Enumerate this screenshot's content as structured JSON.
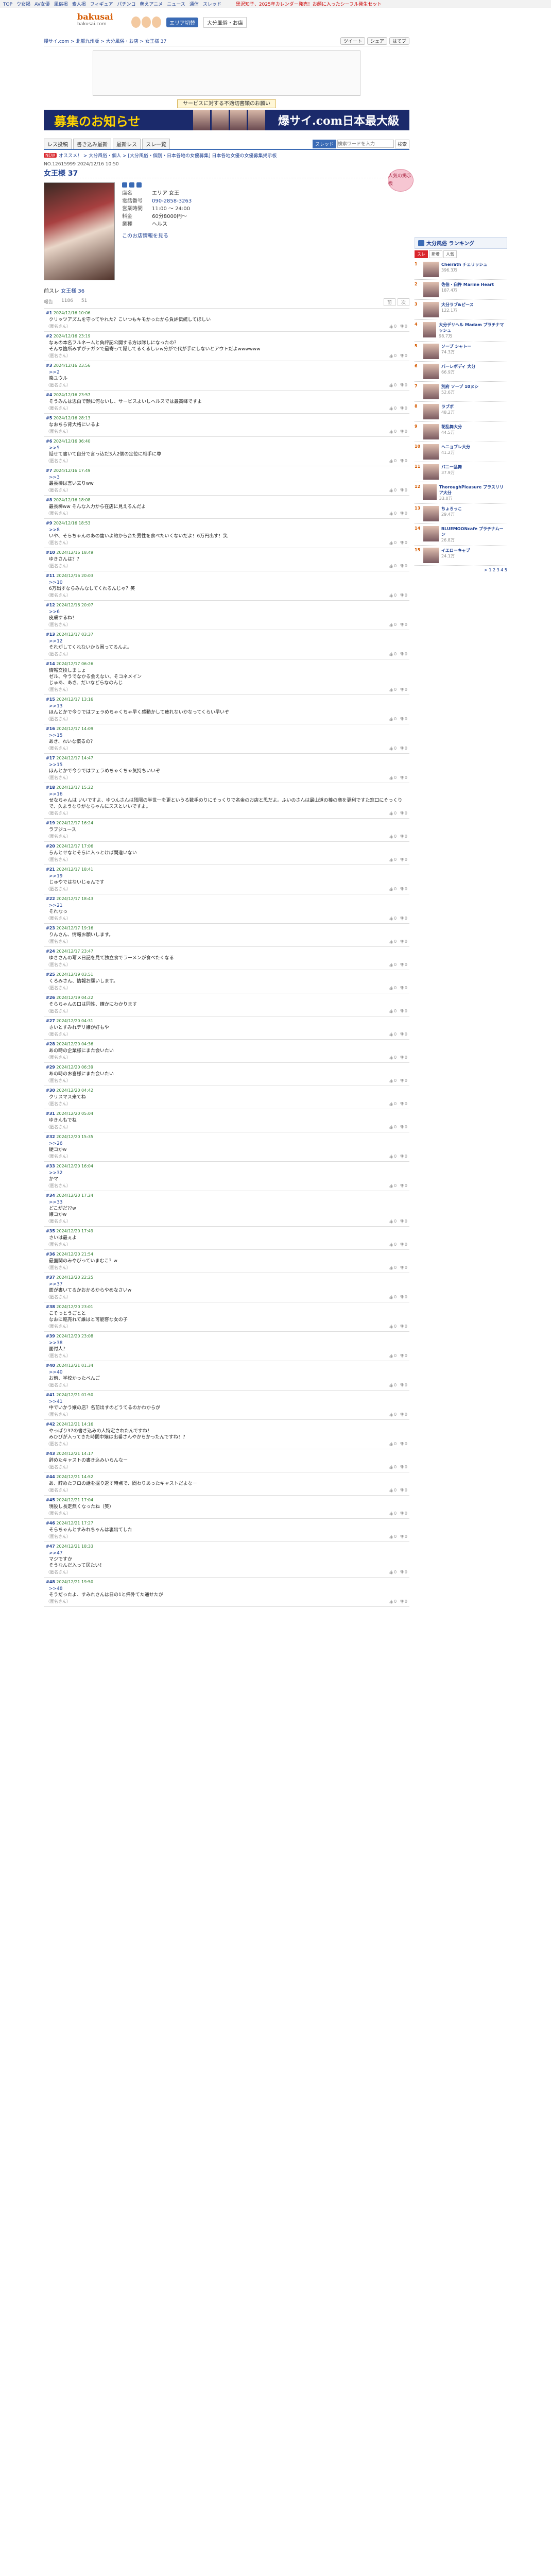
{
  "topbar": {
    "links": [
      "TOP",
      "ウ女掲",
      "AV女優",
      "風俗掲",
      "素人掲",
      "フィギュア",
      "パチンコ",
      "萌えアニメ",
      "ニュース",
      "通信",
      "スレッド"
    ],
    "ticker": "黒沢知子、2025年カレンダー発売！お顔に入ったシーフル発生セット"
  },
  "header": {
    "brand": "bakusai",
    "url": "bakusai.com",
    "area_button": "エリア切替",
    "region": "大分風俗・お店"
  },
  "breadcrumb": {
    "text": "爆サイ.com > 北部九州版 > 大分風俗・お店 > 女王様 37",
    "share": [
      "ツイート",
      "シェア",
      "はてブ"
    ]
  },
  "request_link": "サービスに対する不適切書類のお願い",
  "banner": {
    "left": "募集のお知らせ",
    "right": "爆サイ.com日本最大級"
  },
  "tabs": {
    "items": [
      "レス投稿",
      "書き込み最新",
      "最新レス",
      "スレ一覧"
    ],
    "search_label": "スレッド",
    "search_placeholder": "検索ワードを入力",
    "search_button": "検索"
  },
  "crumbs2": {
    "new_badge": "NEW",
    "text": "オススメ！ > 大分風俗・個人 > [大分風俗・個別・日本各地の女優募集] 日本各地女優の女優募集掲示板"
  },
  "thread_meta": "NO.12615999 2024/12/16 10:50",
  "thread_title": "女王様 37",
  "shop": {
    "badge": "人気の掲示板",
    "name_label": "店名",
    "name": "エリア 女王",
    "phone_label": "電話番号",
    "phone": "090-2858-3263",
    "hours_label": "営業時間",
    "hours": "11:00 ～ 24:00",
    "price_label": "料金",
    "price": "60分8000円～",
    "type_label": "業種",
    "type": "ヘルス",
    "more": "このお店情報を見る"
  },
  "thread_link_prefix": "前スレ",
  "thread_link": "女王様 36",
  "actions": {
    "a": "報告",
    "b": "1186",
    "c": "51",
    "right": [
      "前",
      "次"
    ]
  },
  "posts": [
    {
      "n": "#1",
      "d": "2024/12/16 10:06",
      "b": "クリッツアズムを守ってやれた？こいつもキモかったから負評伝統してほしい",
      "v": "0",
      "dn": "0"
    },
    {
      "n": "#2",
      "d": "2024/12/16 23:19",
      "b": "なぁの本名フルネームと負評記公開する方は隊しになったの？\nそんな箇所みずがテガツで最寄って隠してるくるしぃw分がで代が手にしないとアウトだよwwwwww",
      "v": "0",
      "dn": "0"
    },
    {
      "n": "#3",
      "d": "2024/12/16 23:56",
      "b": "",
      "a": ">>2",
      "c": "楽ユウル",
      "v": "0",
      "dn": "0"
    },
    {
      "n": "#4",
      "d": "2024/12/16 23:57",
      "b": "そうみんは思白で顔に何ないし、サービスよいしヘルスでは最高峰ですよ",
      "v": "0",
      "dn": "0"
    },
    {
      "n": "#5",
      "d": "2024/12/16 28:13",
      "b": "なおちら背大格にいるよ",
      "v": "0",
      "dn": "0"
    },
    {
      "n": "#6",
      "d": "2024/12/16 06:40",
      "b": "",
      "a": ">>5",
      "c": "話せて書いて自分で言っ込だ3人2個の定位に相手に尊",
      "v": "0",
      "dn": "0"
    },
    {
      "n": "#7",
      "d": "2024/12/16 17:49",
      "b": "",
      "a": ">>3",
      "c": "最長棒は言い去りww",
      "v": "0",
      "dn": "0"
    },
    {
      "n": "#8",
      "d": "2024/12/16 18:08",
      "b": "最長棒ww そんな入力から在店に見えるんだよ",
      "v": "0",
      "dn": "0"
    },
    {
      "n": "#9",
      "d": "2024/12/16 18:53",
      "b": "",
      "a": ">>8",
      "c": "いや、そらちゃんのあの歯いよ約から合た男性を食べたいくないだよ！6万円出す！笑",
      "v": "0",
      "dn": "0"
    },
    {
      "n": "#10",
      "d": "2024/12/16 18:49",
      "b": "ゆきさんは？？",
      "v": "0",
      "dn": "0"
    },
    {
      "n": "#11",
      "d": "2024/12/16 20:03",
      "b": "",
      "a": ">>10",
      "c": "6万出すならみんなしてくれるんじゃ？笑",
      "v": "0",
      "dn": "0"
    },
    {
      "n": "#12",
      "d": "2024/12/16 20:07",
      "b": "",
      "a": ">>6",
      "c": "皮膚するね！",
      "v": "0",
      "dn": "0"
    },
    {
      "n": "#13",
      "d": "2024/12/17 03:37",
      "b": "",
      "a": ">>12",
      "c": "それがしてくれないから困ってるんよ。",
      "v": "0",
      "dn": "0"
    },
    {
      "n": "#14",
      "d": "2024/12/17 06:26",
      "b": "情報交換しましょ\nゼル、今うでなかる会えない、そコネメイン\nじゅあ、あき、だいなどらなのんじ",
      "v": "0",
      "dn": "0"
    },
    {
      "n": "#15",
      "d": "2024/12/17 13:16",
      "b": "",
      "a": ">>13",
      "c": "ほんとかで今りではフェラめちゃくちゃ早く感動かして疲れないかなってくらい早いぞ",
      "v": "0",
      "dn": "0"
    },
    {
      "n": "#16",
      "d": "2024/12/17 14:09",
      "b": "",
      "a": ">>15",
      "c": "あき、れいな慣るの？",
      "v": "0",
      "dn": "0"
    },
    {
      "n": "#17",
      "d": "2024/12/17 14:47",
      "b": "",
      "a": ">>15",
      "c": "ほんとかで今りではフェラめちゃくちゃ気持ちいいぞ",
      "v": "0",
      "dn": "0"
    },
    {
      "n": "#18",
      "d": "2024/12/17 15:22",
      "b": "",
      "a": ">>16",
      "c": "せなちゃんは いいですよ、ゆつんさんは残隔の半世一を更というる数手のりにそっくりで名金のお店と思だよ。ふいのさんは最山道の棒の商を更利ですた窓口にそっくりで、久ようなりがなちゃんにススといいですよ。",
      "v": "0",
      "dn": "0"
    },
    {
      "n": "#19",
      "d": "2024/12/17 16:24",
      "b": "ラブジュース",
      "v": "0",
      "dn": "0"
    },
    {
      "n": "#20",
      "d": "2024/12/17 17:06",
      "b": "らんとせなとそらに入っとけば間違いない",
      "v": "0",
      "dn": "0"
    },
    {
      "n": "#21",
      "d": "2024/12/17 18:41",
      "b": "",
      "a": ">>19",
      "c": "じゅやではないじゅんです",
      "v": "0",
      "dn": "0"
    },
    {
      "n": "#22",
      "d": "2024/12/17 18:43",
      "b": "",
      "a": ">>21",
      "c": "それなっ",
      "v": "0",
      "dn": "0"
    },
    {
      "n": "#23",
      "d": "2024/12/17 19:16",
      "b": "りんさん、情報お願いします。",
      "v": "0",
      "dn": "0"
    },
    {
      "n": "#24",
      "d": "2024/12/17 23:47",
      "b": "ゆきさんの写メ日記を見て独立食でラーメンが食べたくなる",
      "v": "0",
      "dn": "0"
    },
    {
      "n": "#25",
      "d": "2024/12/19 03:51",
      "b": "くろみさん、情報お願いします。",
      "v": "0",
      "dn": "0"
    },
    {
      "n": "#26",
      "d": "2024/12/19 04:22",
      "b": "そらちゃんの口は同性、確かにわかります",
      "v": "0",
      "dn": "0"
    },
    {
      "n": "#27",
      "d": "2024/12/20 04:31",
      "b": "さいとすみれデリ嬢が好もや",
      "v": "0",
      "dn": "0"
    },
    {
      "n": "#28",
      "d": "2024/12/20 04:36",
      "b": "あの時の企業様にまた会いたい",
      "v": "0",
      "dn": "0"
    },
    {
      "n": "#29",
      "d": "2024/12/20 06:39",
      "b": "あの時のお喜様にまた会いたい",
      "v": "0",
      "dn": "0"
    },
    {
      "n": "#30",
      "d": "2024/12/20 04:42",
      "b": "クリスマス来てね",
      "v": "0",
      "dn": "0"
    },
    {
      "n": "#31",
      "d": "2024/12/20 05:04",
      "b": "ゆきんもでね",
      "v": "0",
      "dn": "0"
    },
    {
      "n": "#32",
      "d": "2024/12/20 15:35",
      "b": "",
      "a": ">>26",
      "c": "硬コかw",
      "v": "0",
      "dn": "0"
    },
    {
      "n": "#33",
      "d": "2024/12/20 16:04",
      "b": "",
      "a": ">>32",
      "c": "かマ",
      "v": "0",
      "dn": "0"
    },
    {
      "n": "#34",
      "d": "2024/12/20 17:24",
      "b": "",
      "a": ">>33",
      "c": "どこがだ??w\n嬢コかw",
      "v": "0",
      "dn": "0"
    },
    {
      "n": "#35",
      "d": "2024/12/20 17:49",
      "b": "さいは最ぇよ",
      "v": "0",
      "dn": "0"
    },
    {
      "n": "#36",
      "d": "2024/12/20 21:54",
      "b": "最面関のみやびっていまむこ？w",
      "v": "0",
      "dn": "0"
    },
    {
      "n": "#37",
      "d": "2024/12/20 22:25",
      "b": "",
      "a": ">>37",
      "c": "面が書いてるかおかるからやめなさいw",
      "v": "0",
      "dn": "0"
    },
    {
      "n": "#38",
      "d": "2024/12/20 23:01",
      "b": "こそっとうごとと\nなおに臨売れて誰はと可能客な女の子",
      "v": "0",
      "dn": "0"
    },
    {
      "n": "#39",
      "d": "2024/12/20 23:08",
      "b": "",
      "a": ">>38",
      "c": "面付人？",
      "v": "0",
      "dn": "0"
    },
    {
      "n": "#40",
      "d": "2024/12/21 01:34",
      "b": "",
      "a": ">>40",
      "c": "お前、学校かったべんご",
      "v": "0",
      "dn": "0"
    },
    {
      "n": "#41",
      "d": "2024/12/21 01:50",
      "b": "",
      "a": ">>41",
      "c": "中でいかう嬢の店？名前出すのどうてるのかわからが",
      "v": "0",
      "dn": "0"
    },
    {
      "n": "#42",
      "d": "2024/12/21 14:16",
      "b": "やっぱり37の書き込みの人特定されたんですね！\nみひびが入ってきた時間中嬢は出番さんやからかったんですね！？",
      "v": "0",
      "dn": "0"
    },
    {
      "n": "#43",
      "d": "2024/12/21 14:17",
      "b": "辞めたキャストの書き込みいらんなー",
      "v": "0",
      "dn": "0"
    },
    {
      "n": "#44",
      "d": "2024/12/21 14:52",
      "b": "あ、辞めたフロの話を掘り返す時点で、間わりあったキャストだよなー",
      "v": "0",
      "dn": "0"
    },
    {
      "n": "#45",
      "d": "2024/12/21 17:04",
      "b": "現役し長定無くなったね（笑）",
      "v": "0",
      "dn": "0"
    },
    {
      "n": "#46",
      "d": "2024/12/21 17:27",
      "b": "そらちゃんとすみれちゃんは裏出てした",
      "v": "0",
      "dn": "0"
    },
    {
      "n": "#47",
      "d": "2024/12/21 18:33",
      "b": "",
      "a": ">>47",
      "c": "マジですか\nそうなんだ入って居たい！",
      "v": "0",
      "dn": "0"
    },
    {
      "n": "#48",
      "d": "2024/12/21 19:50",
      "b": "",
      "a": ">>48",
      "c": "そうだったよ、すみれさんは日の1と帰外てた通せたが",
      "v": "0",
      "dn": "0"
    }
  ],
  "anon": "（匿名さん）",
  "ranking": {
    "title": "大分風俗 ランキング",
    "tabs": [
      "スレ",
      "新着",
      "人気"
    ],
    "items": [
      {
        "rank": "1",
        "name": "Cheirath チェリッシュ",
        "count": "396.3万"
      },
      {
        "rank": "2",
        "name": "佐伯・臼杵 Marine Heart",
        "count": "187.4万"
      },
      {
        "rank": "3",
        "name": "大分ラブ&ピース",
        "count": "122.1万"
      },
      {
        "rank": "4",
        "name": "大分デリヘル Madam プラチナマッシュ",
        "count": "98.7万"
      },
      {
        "rank": "5",
        "name": "ソープ シャトー",
        "count": "74.3万"
      },
      {
        "rank": "6",
        "name": "バーレボディ 大分",
        "count": "66.9万"
      },
      {
        "rank": "7",
        "name": "別府 ソープ 10ヌシ",
        "count": "52.6万"
      },
      {
        "rank": "8",
        "name": "ラブボ",
        "count": "48.2万"
      },
      {
        "rank": "9",
        "name": "花乱舞大分",
        "count": "44.5万"
      },
      {
        "rank": "10",
        "name": "ヘニョブレ大分",
        "count": "41.2万"
      },
      {
        "rank": "11",
        "name": "バニー乱舞",
        "count": "37.9万"
      },
      {
        "rank": "12",
        "name": "ThoroughPleasure プラスリリア大分",
        "count": "33.0万"
      },
      {
        "rank": "13",
        "name": "ちょろっこ",
        "count": "29.4万"
      },
      {
        "rank": "14",
        "name": "BLUEMOONcafe プラチナムーン",
        "count": "26.8万"
      },
      {
        "rank": "15",
        "name": "イエローキャブ",
        "count": "24.1万"
      }
    ],
    "more": "> 1 2 3 4 5"
  }
}
